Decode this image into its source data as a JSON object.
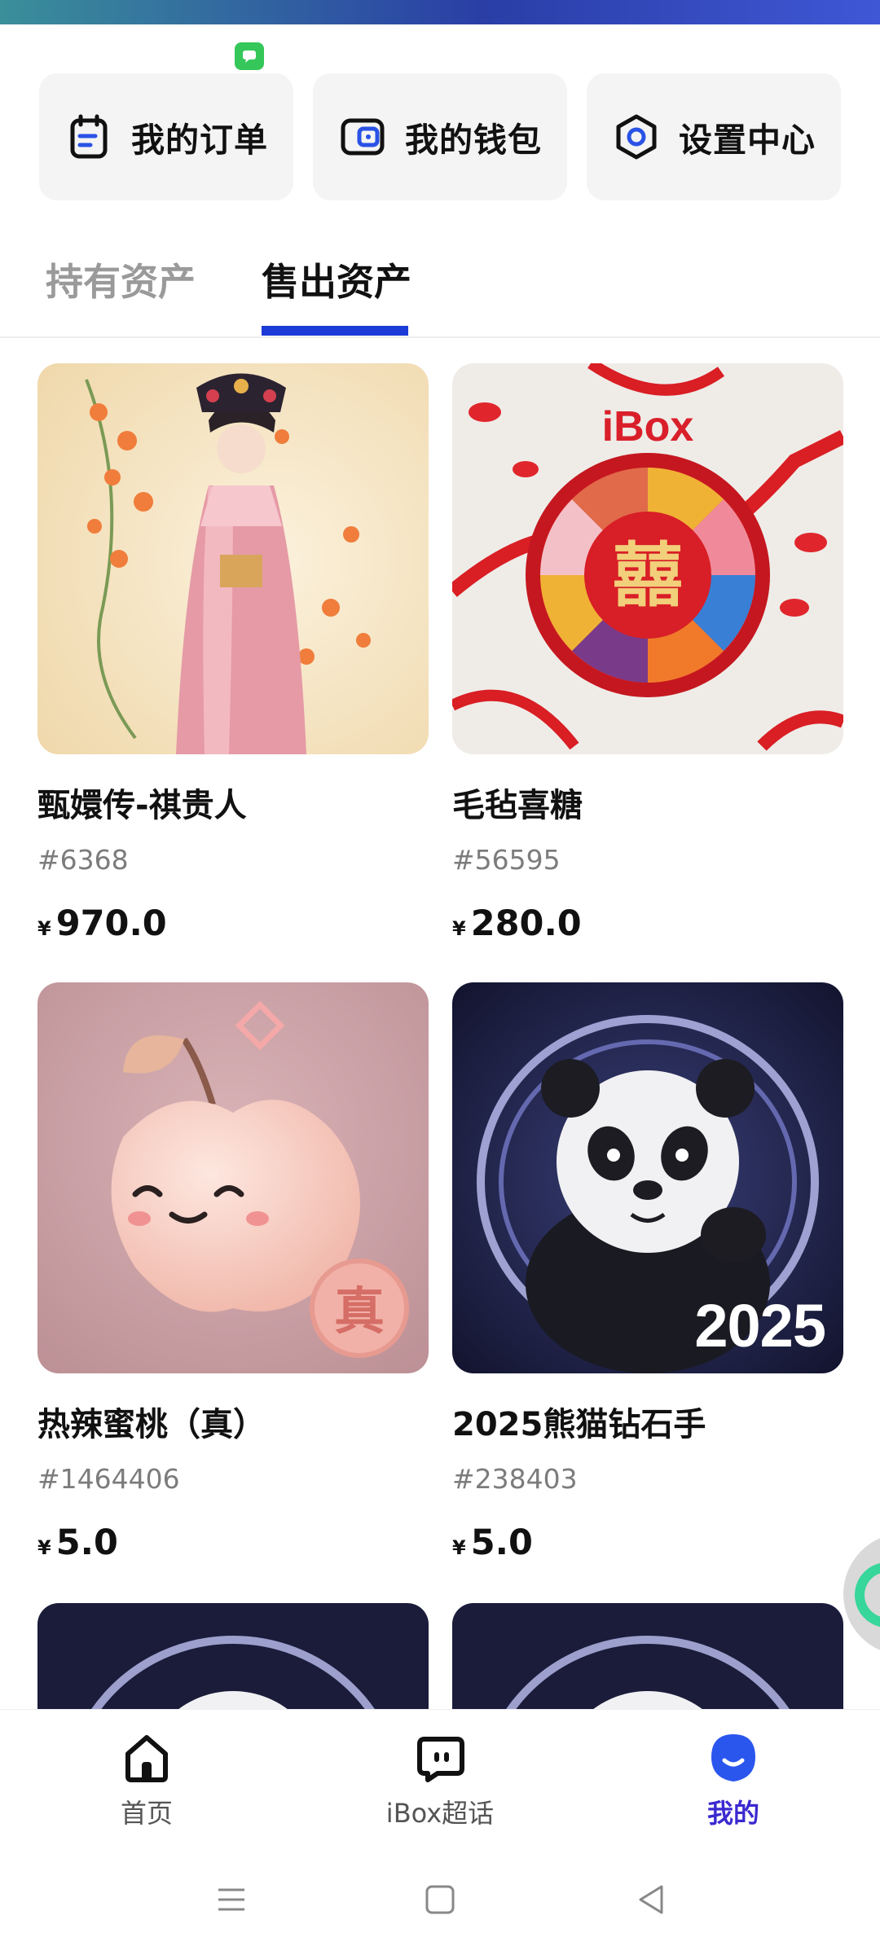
{
  "quick_actions": [
    {
      "label": "我的订单",
      "icon": "order-icon"
    },
    {
      "label": "我的钱包",
      "icon": "wallet-icon"
    },
    {
      "label": "设置中心",
      "icon": "settings-icon"
    }
  ],
  "tabs": {
    "held": "持有资产",
    "sold": "售出资产",
    "active": "sold"
  },
  "assets": [
    {
      "title": "甄嬛传-祺贵人",
      "serial": "#6368",
      "currency": "¥",
      "price": "970.0",
      "image": "qing-dynasty-lady-illustration"
    },
    {
      "title": "毛毡喜糖",
      "serial": "#56595",
      "currency": "¥",
      "price": "280.0",
      "image": "felt-wedding-candy-box",
      "image_text": "iBox"
    },
    {
      "title": "热辣蜜桃（真）",
      "serial": "#1464406",
      "currency": "¥",
      "price": "5.0",
      "image": "smiling-peach",
      "image_text": "真"
    },
    {
      "title": "2025熊猫钻石手",
      "serial": "#238403",
      "currency": "¥",
      "price": "5.0",
      "image": "panda-with-sparkle-ring",
      "image_text": "2025"
    }
  ],
  "bottom_nav": [
    {
      "label": "首页",
      "icon": "home-icon",
      "active": false
    },
    {
      "label": "iBox超话",
      "icon": "chat-icon",
      "active": false
    },
    {
      "label": "我的",
      "icon": "profile-icon",
      "active": true
    }
  ],
  "colors": {
    "accent": "#1d3bd6",
    "active_nav": "#3b2ad0",
    "card_bg": "#f4f4f4"
  }
}
